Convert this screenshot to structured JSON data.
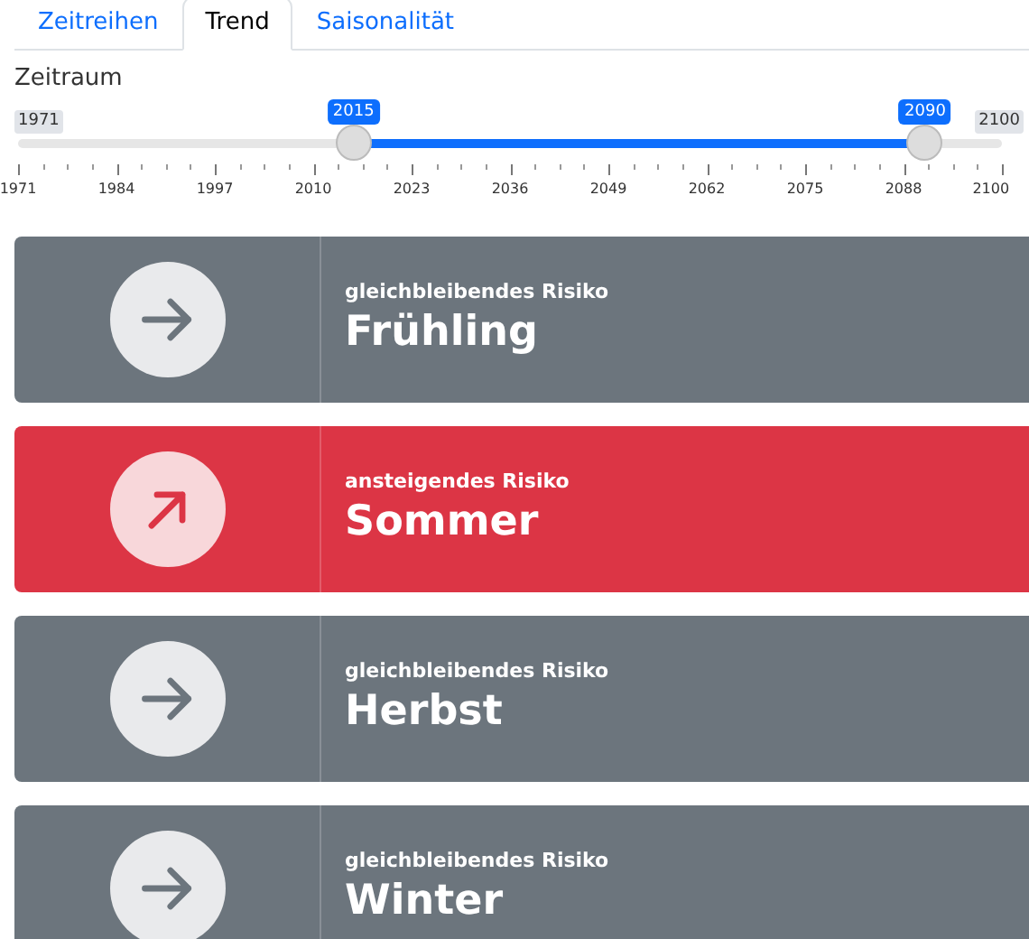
{
  "tabs": [
    {
      "label": "Zeitreihen",
      "selected": false
    },
    {
      "label": "Trend",
      "selected": true
    },
    {
      "label": "Saisonalität",
      "selected": false
    }
  ],
  "slider": {
    "label": "Zeitraum",
    "min_label": "1971",
    "max_label": "2100",
    "handles": [
      {
        "label": "2015",
        "level": 0.341
      },
      {
        "label": "2090",
        "level": 0.922
      }
    ],
    "ticks": [
      "1971",
      "1984",
      "1997",
      "2010",
      "2023",
      "2036",
      "2049",
      "2062",
      "2075",
      "2088",
      "2100"
    ]
  },
  "seasons": [
    {
      "kind": "steady",
      "risk": "gleichbleibendes Risiko",
      "name": "Frühling"
    },
    {
      "kind": "rising",
      "risk": "ansteigendes Risiko",
      "name": "Sommer"
    },
    {
      "kind": "steady",
      "risk": "gleichbleibendes Risiko",
      "name": "Herbst"
    },
    {
      "kind": "steady",
      "risk": "gleichbleibendes Risiko",
      "name": "Winter"
    }
  ]
}
